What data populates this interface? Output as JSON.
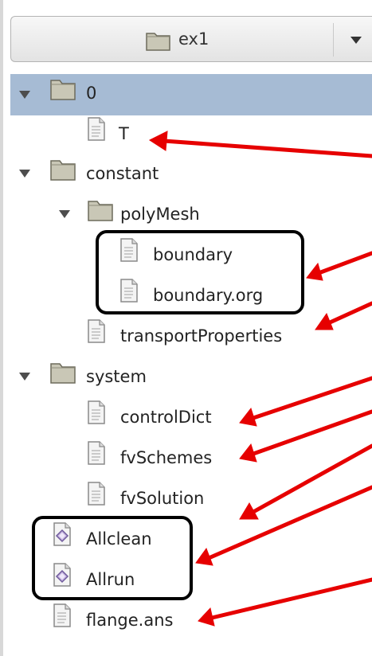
{
  "project_selector": {
    "value": "ex1"
  },
  "tree": {
    "folder_0": "0",
    "file_T": "T",
    "folder_constant": "constant",
    "folder_polymesh": "polyMesh",
    "file_boundary": "boundary",
    "file_boundary_org": "boundary.org",
    "file_transport": "transportProperties",
    "folder_system": "system",
    "file_controldict": "controlDict",
    "file_fvschemes": "fvSchemes",
    "file_fvsolution": "fvSolution",
    "script_allclean": "Allclean",
    "script_allrun": "Allrun",
    "file_flange": "flange.ans"
  },
  "colors": {
    "selection": "#a6bbd4",
    "arrow": "#e60000",
    "highlight_box": "#000000",
    "folder_fill": "#c9c7b6"
  },
  "icons": {
    "folder": "folder-icon",
    "file": "text-file-icon",
    "script": "script-file-icon",
    "expander": "expand-triangle-icon",
    "dropdown": "chevron-down-icon"
  }
}
